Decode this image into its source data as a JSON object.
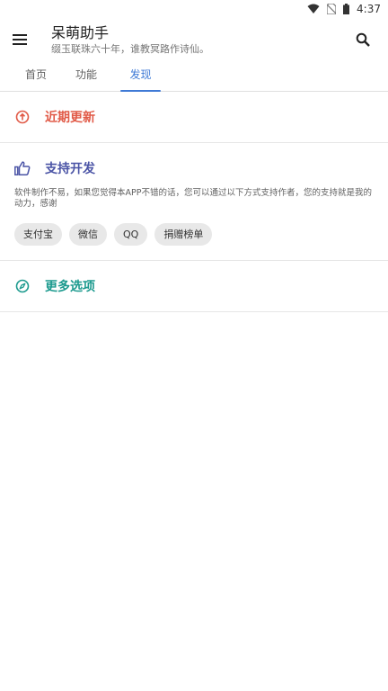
{
  "status_bar": {
    "time": "4:37",
    "icons": [
      "wifi-icon",
      "no-sim-icon",
      "battery-icon"
    ]
  },
  "app_bar": {
    "title": "呆萌助手",
    "subtitle": "缀玉联珠六十年，谁教冥路作诗仙。",
    "menu_icon": "menu-icon",
    "search_icon": "search-icon"
  },
  "tabs": [
    {
      "label": "首页",
      "active": false
    },
    {
      "label": "功能",
      "active": false
    },
    {
      "label": "发现",
      "active": true
    }
  ],
  "sections": {
    "recent_updates": {
      "title": "近期更新",
      "icon": "upload-circle-icon",
      "color": "#e15a47"
    },
    "support": {
      "title": "支持开发",
      "icon": "thumb-up-icon",
      "color": "#4b54a6",
      "description": "软件制作不易，如果您觉得本APP不错的话，您可以通过以下方式支持作者，您的支持就是我的动力，感谢",
      "chips": [
        "支付宝",
        "微信",
        "QQ",
        "捐赠榜单"
      ]
    },
    "more_options": {
      "title": "更多选项",
      "icon": "compass-icon",
      "color": "#1c9a8e"
    }
  },
  "colors": {
    "accent": "#3f7ad6",
    "divider": "#e6e6e6",
    "chip_bg": "#e8e8e8"
  }
}
